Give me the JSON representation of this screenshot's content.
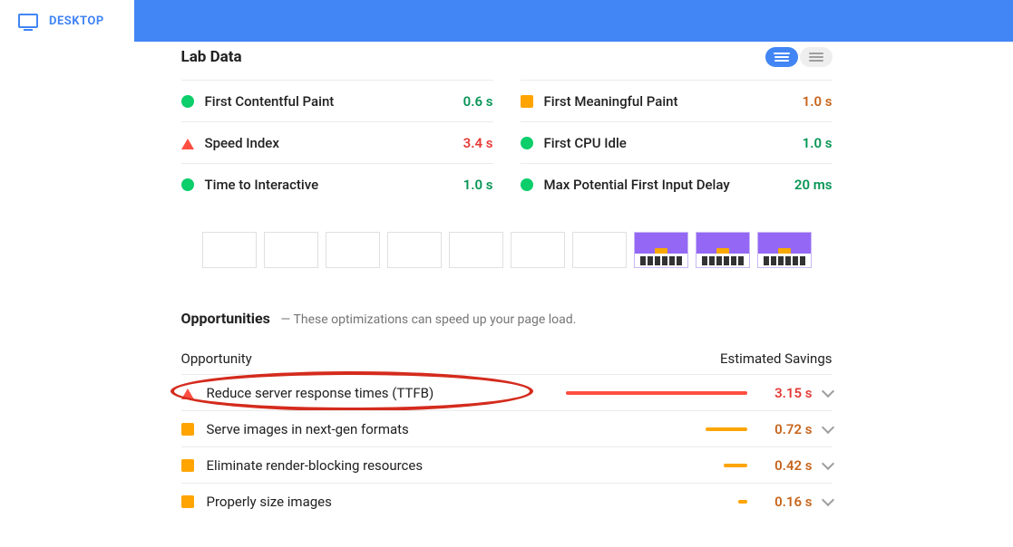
{
  "header": {
    "tab_desktop": "DESKTOP"
  },
  "labdata": {
    "title": "Lab Data",
    "metrics": [
      {
        "name": "First Contentful Paint",
        "value": "0.6 s",
        "status": "green"
      },
      {
        "name": "First Meaningful Paint",
        "value": "1.0 s",
        "status": "orange"
      },
      {
        "name": "Speed Index",
        "value": "3.4 s",
        "status": "red"
      },
      {
        "name": "First CPU Idle",
        "value": "1.0 s",
        "status": "green"
      },
      {
        "name": "Time to Interactive",
        "value": "1.0 s",
        "status": "green"
      },
      {
        "name": "Max Potential First Input Delay",
        "value": "20 ms",
        "status": "green"
      }
    ]
  },
  "opportunities": {
    "title": "Opportunities",
    "subtitle": "— These optimizations can speed up your page load.",
    "col_left": "Opportunity",
    "col_right": "Estimated Savings",
    "rows": [
      {
        "name": "Reduce server response times (TTFB)",
        "value": "3.15 s",
        "status": "red",
        "bar_pct": 100,
        "highlighted": true
      },
      {
        "name": "Serve images in next-gen formats",
        "value": "0.72 s",
        "status": "orange",
        "bar_pct": 23
      },
      {
        "name": "Eliminate render-blocking resources",
        "value": "0.42 s",
        "status": "orange",
        "bar_pct": 13
      },
      {
        "name": "Properly size images",
        "value": "0.16 s",
        "status": "orange",
        "bar_pct": 5
      }
    ]
  }
}
